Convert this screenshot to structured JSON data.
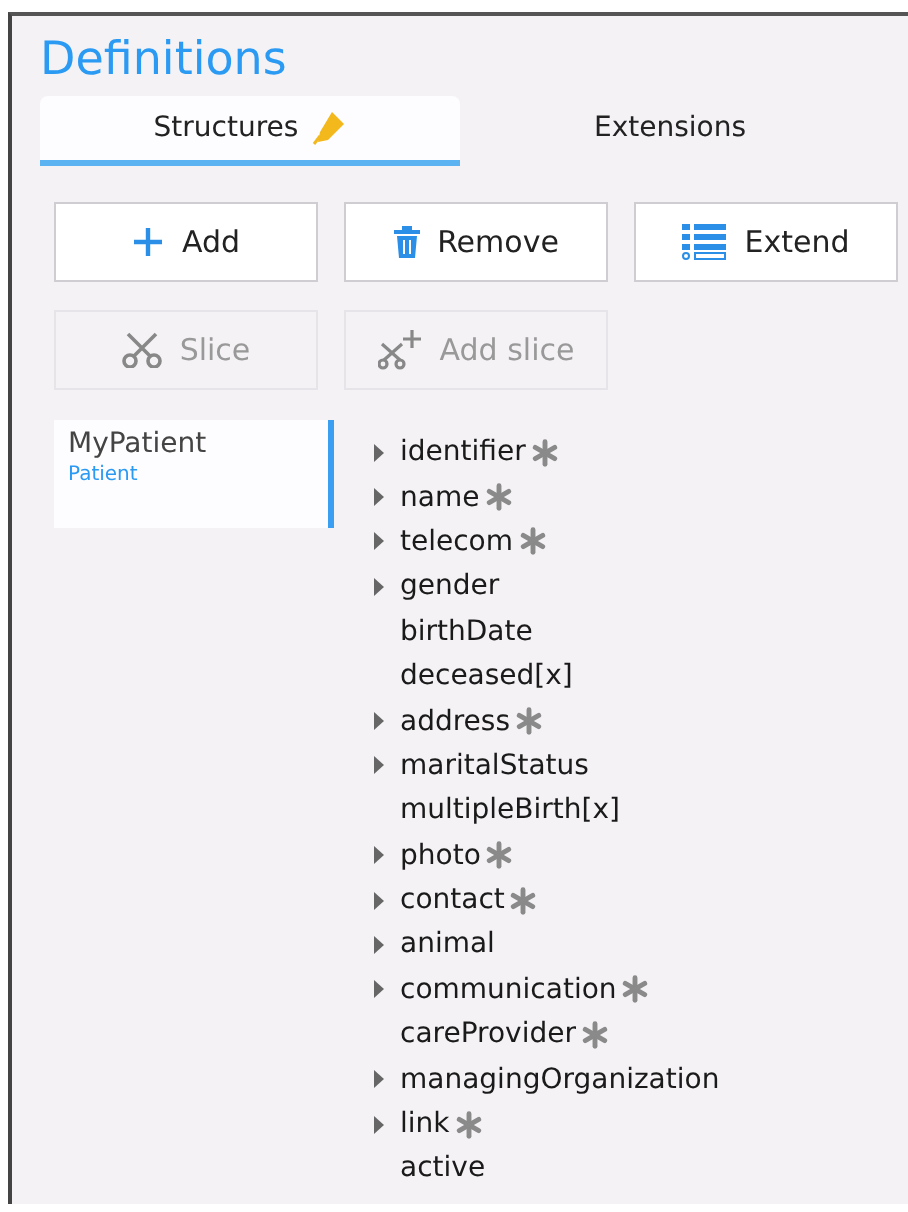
{
  "title": "Definitions",
  "tabs": [
    {
      "label": "Structures",
      "selected": true,
      "editing": true
    },
    {
      "label": "Extensions",
      "selected": false,
      "editing": false
    }
  ],
  "buttons": [
    {
      "kind": "add",
      "label": "Add",
      "disabled": false
    },
    {
      "kind": "remove",
      "label": "Remove",
      "disabled": false
    },
    {
      "kind": "extend",
      "label": "Extend",
      "disabled": false
    },
    {
      "kind": "slice",
      "label": "Slice",
      "disabled": true
    },
    {
      "kind": "add-slice",
      "label": "Add slice",
      "disabled": true
    }
  ],
  "structures": [
    {
      "name": "MyPatient",
      "base": "Patient",
      "selected": true
    }
  ],
  "elements": [
    {
      "name": "identifier",
      "expandable": true,
      "repeating": true
    },
    {
      "name": "name",
      "expandable": true,
      "repeating": true
    },
    {
      "name": "telecom",
      "expandable": true,
      "repeating": true
    },
    {
      "name": "gender",
      "expandable": true,
      "repeating": false
    },
    {
      "name": "birthDate",
      "expandable": false,
      "repeating": false
    },
    {
      "name": "deceased[x]",
      "expandable": false,
      "repeating": false
    },
    {
      "name": "address",
      "expandable": true,
      "repeating": true
    },
    {
      "name": "maritalStatus",
      "expandable": true,
      "repeating": false
    },
    {
      "name": "multipleBirth[x]",
      "expandable": false,
      "repeating": false
    },
    {
      "name": "photo",
      "expandable": true,
      "repeating": true
    },
    {
      "name": "contact",
      "expandable": true,
      "repeating": true
    },
    {
      "name": "animal",
      "expandable": true,
      "repeating": false
    },
    {
      "name": "communication",
      "expandable": true,
      "repeating": true
    },
    {
      "name": "careProvider",
      "expandable": false,
      "repeating": true
    },
    {
      "name": "managingOrganization",
      "expandable": true,
      "repeating": false
    },
    {
      "name": "link",
      "expandable": true,
      "repeating": true
    },
    {
      "name": "active",
      "expandable": false,
      "repeating": false
    }
  ]
}
